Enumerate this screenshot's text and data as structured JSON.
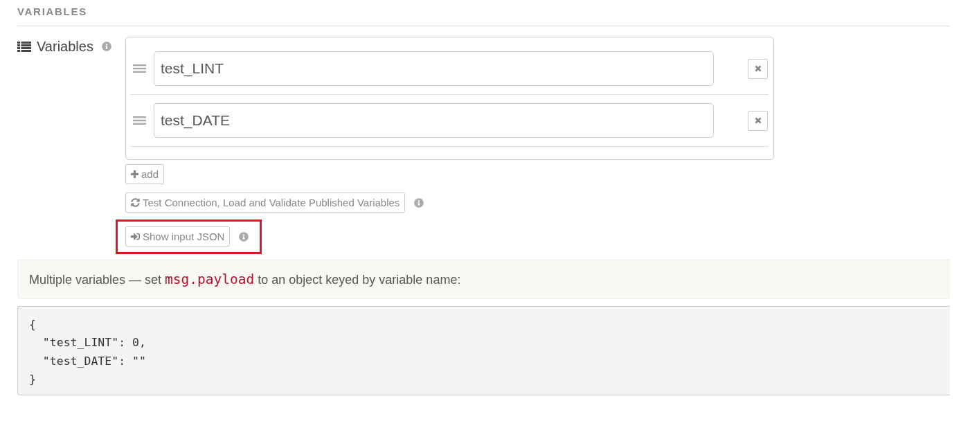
{
  "section": {
    "title": "VARIABLES"
  },
  "field": {
    "label": "Variables",
    "info": true
  },
  "variables": [
    {
      "value": "test_LINT"
    },
    {
      "value": "test_DATE"
    }
  ],
  "buttons": [
    {
      "kind": "add",
      "label": "add",
      "info": false,
      "highlighted": false
    },
    {
      "kind": "refresh",
      "label": "Test Connection, Load and Validate Published Variables",
      "info": true,
      "highlighted": false
    },
    {
      "kind": "sign-in",
      "label": "Show input JSON",
      "info": true,
      "highlighted": true
    }
  ],
  "note": {
    "parts": [
      {
        "kind": "text",
        "text": "Multiple variables — set "
      },
      {
        "kind": "code",
        "text": "msg.payload"
      },
      {
        "kind": "text",
        "text": " to an object keyed by variable name:"
      }
    ]
  },
  "code_lines": [
    "{",
    "  \"test_LINT\": 0,",
    "  \"test_DATE\": \"\"",
    "}"
  ]
}
